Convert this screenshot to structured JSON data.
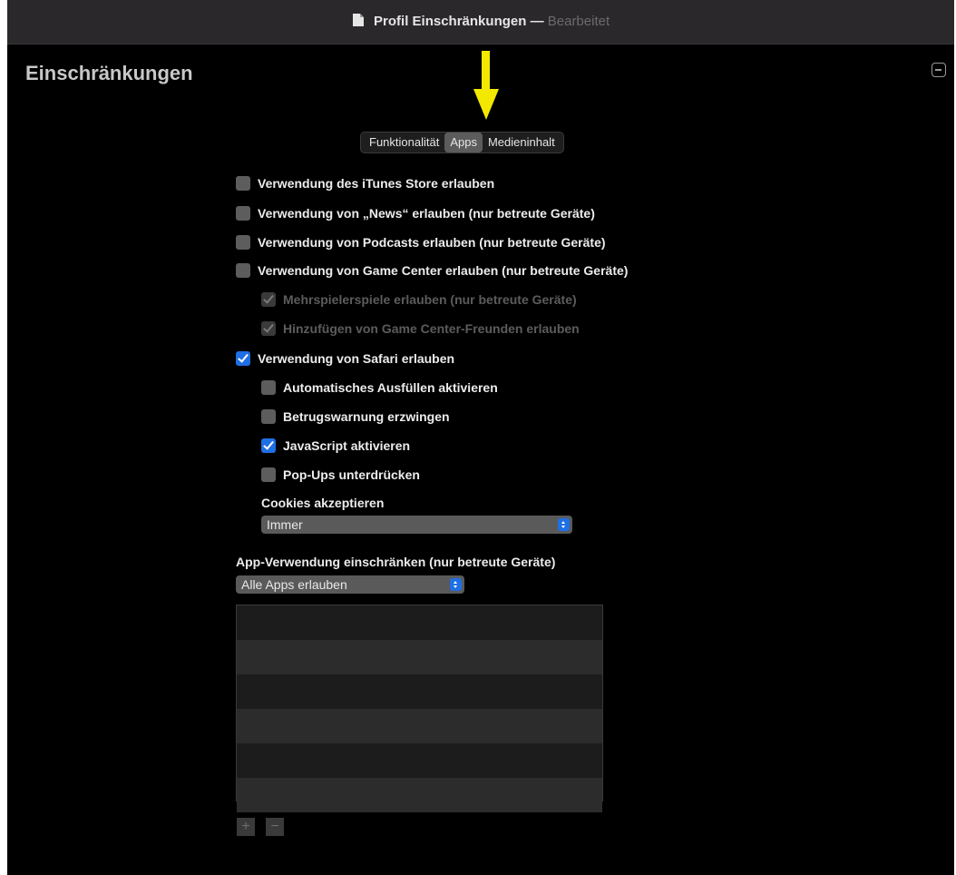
{
  "window": {
    "title": "Profil Einschränkungen",
    "title_separator": "—",
    "title_status": "Bearbeitet"
  },
  "section": {
    "heading": "Einschränkungen"
  },
  "tabs": [
    {
      "label": "Funktionalität",
      "selected": false
    },
    {
      "label": "Apps",
      "selected": true
    },
    {
      "label": "Medieninhalt",
      "selected": false
    }
  ],
  "options": {
    "itunes": {
      "label": "Verwendung des iTunes Store erlauben",
      "checked": false
    },
    "news": {
      "label": "Verwendung von „News“ erlauben (nur betreute Geräte)",
      "checked": false
    },
    "podcasts": {
      "label": "Verwendung von Podcasts erlauben (nur betreute Geräte)",
      "checked": false
    },
    "game_center": {
      "label": "Verwendung von Game Center erlauben (nur betreute Geräte)",
      "checked": false
    },
    "multiplayer": {
      "label": "Mehrspielerspiele erlauben (nur betreute Geräte)",
      "checked": true,
      "enabled": false
    },
    "friends": {
      "label": "Hinzufügen von Game Center-Freunden erlauben",
      "checked": true,
      "enabled": false
    },
    "safari": {
      "label": "Verwendung von Safari erlauben",
      "checked": true
    },
    "autofill": {
      "label": "Automatisches Ausfüllen aktivieren",
      "checked": false
    },
    "fraud_warning": {
      "label": "Betrugswarnung erzwingen",
      "checked": false
    },
    "javascript": {
      "label": "JavaScript aktivieren",
      "checked": true
    },
    "popups": {
      "label": "Pop-Ups unterdrücken",
      "checked": false
    }
  },
  "cookies": {
    "label": "Cookies akzeptieren",
    "value": "Immer"
  },
  "app_usage": {
    "label": "App-Verwendung einschränken (nur betreute Geräte)",
    "value": "Alle Apps erlauben"
  },
  "list_buttons": {
    "add": "+",
    "remove": "−"
  },
  "colors": {
    "accent": "#1f6fe5",
    "annotation_arrow": "#f2e800",
    "background": "#000000"
  }
}
